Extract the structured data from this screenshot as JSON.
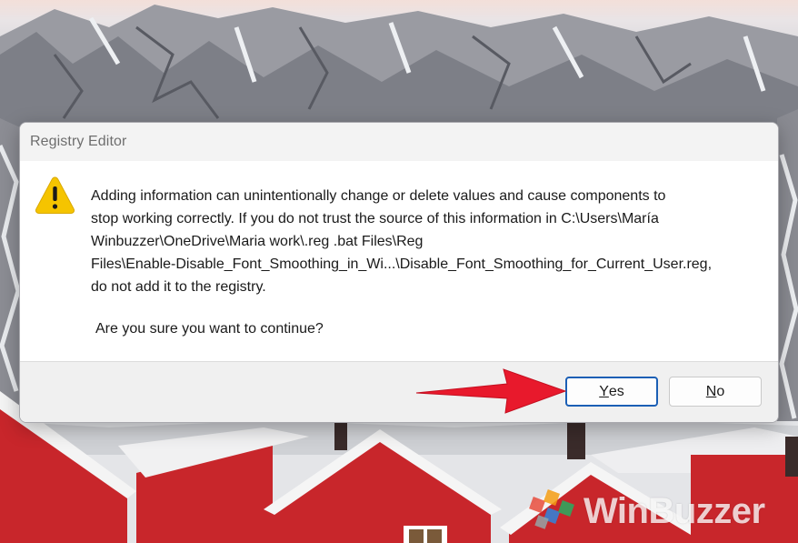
{
  "dialog": {
    "title": "Registry Editor",
    "icon": "warning-icon",
    "message": "Adding information can unintentionally change or delete values and cause components to\nstop working correctly. If you do not trust the source of this information in C:\\Users\\María\nWinbuzzer\\OneDrive\\Maria work\\.reg .bat Files\\Reg\nFiles\\Enable-Disable_Font_Smoothing_in_Wi...\\Disable_Font_Smoothing_for_Current_User.reg,\ndo not add it to the registry.",
    "question": "Are you sure you want to continue?",
    "buttons": {
      "yes": {
        "accel": "Y",
        "rest": "es"
      },
      "no": {
        "accel": "N",
        "rest": "o"
      }
    }
  },
  "annotation": {
    "arrow_color": "#e8192c",
    "points_to": "yes-button"
  },
  "watermark": {
    "text": "WinBuzzer"
  },
  "colors": {
    "accent": "#1b5fb5",
    "house_red": "#c8262b",
    "warning_yellow": "#f5c400"
  }
}
